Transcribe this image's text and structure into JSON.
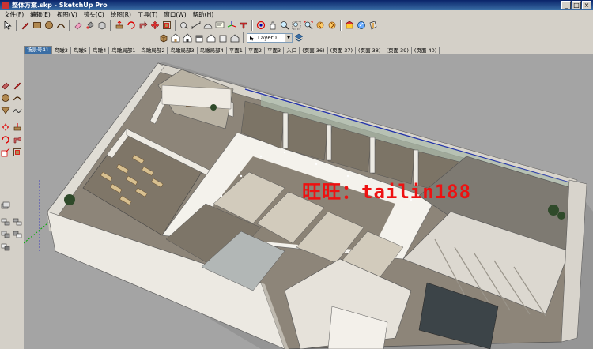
{
  "window": {
    "title": "整体方案.skp - SketchUp Pro",
    "minimize_label": "_",
    "maximize_label": "□",
    "close_label": "×"
  },
  "menu": [
    "文件(F)",
    "编辑(E)",
    "视图(V)",
    "镜头(C)",
    "绘图(R)",
    "工具(T)",
    "窗口(W)",
    "帮助(H)"
  ],
  "layer_select": {
    "value": "Layer0"
  },
  "scene_tabs": [
    "场景号41",
    "鸟瞰3",
    "鸟瞰5",
    "鸟瞰4",
    "鸟瞰局部1",
    "鸟瞰局部2",
    "鸟瞰局部3",
    "鸟瞰局部4",
    "平面1",
    "平面2",
    "平面3",
    "入口",
    "(页面 36)",
    "(页面 37)",
    "(页面 38)",
    "(页面 39)",
    "(页面 40)"
  ],
  "active_scene_index": 0,
  "watermark": "旺旺：tailin188",
  "icons": {
    "main_toolbar": [
      "select-icon",
      "pencil-icon",
      "rectangle-icon",
      "circle-icon",
      "arc-icon",
      "eraser-icon",
      "paint-bucket-icon",
      "make-component-icon",
      "push-pull-icon",
      "rotate-icon",
      "follow-me-icon",
      "move-icon",
      "offset-icon",
      "tape-measure-icon",
      "dimension-icon",
      "protractor-icon",
      "text-icon",
      "axes-icon",
      "3d-text-icon",
      "orbit-icon",
      "pan-icon",
      "zoom-icon",
      "zoom-window-icon",
      "zoom-extents-icon",
      "previous-view-icon",
      "next-view-icon",
      "warehouse-icon",
      "share-model-icon",
      "section-icon"
    ],
    "view_toolbar": [
      "components-icon",
      "iso-view-icon",
      "home-view-icon",
      "front-view-icon",
      "right-view-icon",
      "back-view-icon",
      "left-view-icon",
      "layers-icon"
    ]
  },
  "colors": {
    "titlebar": "#0a246a",
    "watermark": "#e01010",
    "sky": "#a4a4a4",
    "wall": "#e8e5de",
    "floor": "#8d8579"
  }
}
